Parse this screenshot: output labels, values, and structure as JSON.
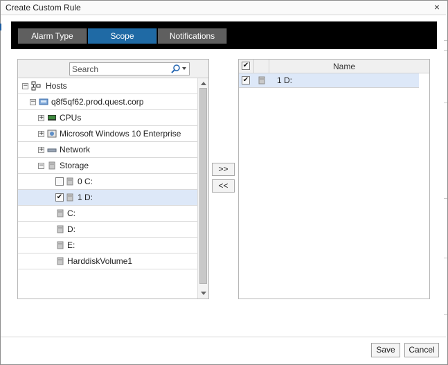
{
  "dialog": {
    "title": "Create Custom Rule",
    "close_glyph": "×"
  },
  "tabs": [
    {
      "label": "Alarm Type",
      "state": "inactive"
    },
    {
      "label": "Scope",
      "state": "active"
    },
    {
      "label": "Notifications",
      "state": "inactive"
    }
  ],
  "search": {
    "placeholder": "Search",
    "value": "",
    "icon": "magnifier-icon"
  },
  "tree": [
    {
      "label": "Hosts",
      "expander": "−",
      "icon": "hosts-icon"
    },
    {
      "label": "q8f5qf62.prod.quest.corp",
      "expander": "−",
      "icon": "host-icon"
    },
    {
      "label": "CPUs",
      "expander": "+",
      "icon": "cpu-icon"
    },
    {
      "label": "Microsoft Windows 10 Enterprise",
      "expander": "+",
      "icon": "os-icon"
    },
    {
      "label": "Network",
      "expander": "+",
      "icon": "network-icon"
    },
    {
      "label": "Storage",
      "expander": "−",
      "icon": "storage-icon"
    },
    {
      "label": "0 C:",
      "checkbox": "",
      "checked": false,
      "icon": "disk-icon"
    },
    {
      "label": "1 D:",
      "checkbox": "✔",
      "checked": true,
      "selected": true,
      "icon": "disk-icon"
    },
    {
      "label": "C:",
      "icon": "disk-icon"
    },
    {
      "label": "D:",
      "icon": "disk-icon"
    },
    {
      "label": "E:",
      "icon": "disk-icon"
    },
    {
      "label": "HarddiskVolume1",
      "icon": "disk-icon"
    }
  ],
  "move_buttons": {
    "add": ">>",
    "remove": "<<"
  },
  "selected_table": {
    "header_check": "✔",
    "name_header": "Name",
    "rows": [
      {
        "checked": true,
        "check": "✔",
        "name": "1 D:",
        "icon": "disk-icon"
      }
    ]
  },
  "footer": {
    "save_label": "Save",
    "cancel_label": "Cancel"
  },
  "colors": {
    "tab_active": "#1f6aa5",
    "tab_inactive": "#5f5f5f",
    "selection": "#dde8f8"
  }
}
